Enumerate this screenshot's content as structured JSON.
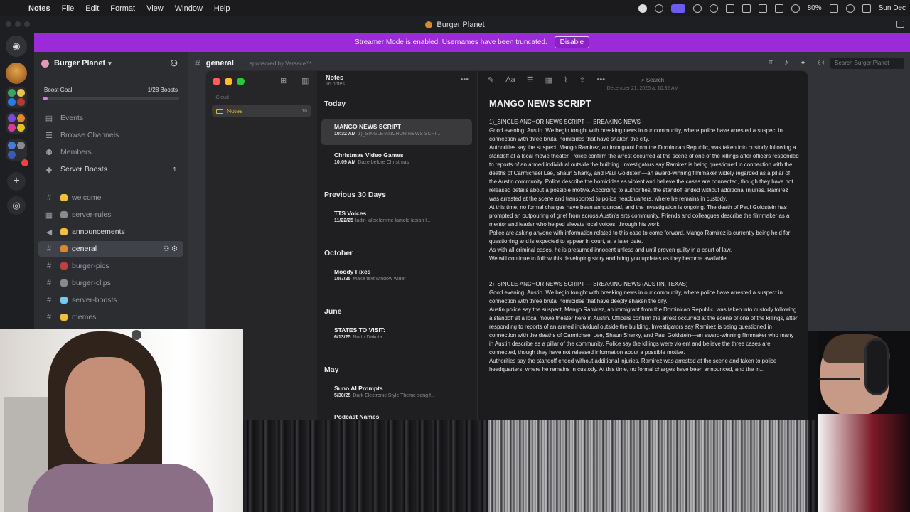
{
  "menubar": {
    "app": "Notes",
    "items": [
      "File",
      "Edit",
      "Format",
      "View",
      "Window",
      "Help"
    ],
    "battery": "80%",
    "clock": "Sun Dec"
  },
  "discord": {
    "window_title": "Burger Planet",
    "banner": {
      "text": "Streamer Mode is enabled. Usernames have been truncated.",
      "button": "Disable"
    },
    "server": {
      "name": "Burger Planet",
      "boost_goal": "Boost Goal",
      "boost_count": "1/28 Boosts",
      "boost_progress": 0.036
    },
    "nav": [
      {
        "label": "Events",
        "icon": "calendar-icon"
      },
      {
        "label": "Browse Channels",
        "icon": "browse-icon"
      },
      {
        "label": "Members",
        "icon": "members-icon"
      },
      {
        "label": "Server Boosts",
        "icon": "boost-icon",
        "count": "1"
      }
    ],
    "channels": [
      {
        "label": "welcome",
        "color": "#f0c040"
      },
      {
        "label": "server-rules",
        "color": "#8a8a8a"
      },
      {
        "label": "announcements",
        "color": "#f0c040"
      },
      {
        "label": "general",
        "color": "#e0842c"
      },
      {
        "label": "burger-pics",
        "color": "#c04040"
      },
      {
        "label": "burger-clips",
        "color": "#8a8a8a"
      },
      {
        "label": "server-boosts",
        "color": "#7ac8f0"
      },
      {
        "label": "memes",
        "color": "#f0c040"
      }
    ],
    "chat": {
      "channel": "general",
      "sponsored": "sponsored by Versace™",
      "search_placeholder": "Search Burger Planet"
    }
  },
  "notes": {
    "list_title": "Notes",
    "list_count": "16 notes",
    "icloud": "iCloud",
    "folder": {
      "label": "Notes",
      "count": "16"
    },
    "search_placeholder": "Search",
    "date_line": "December 21, 2025 at 10:32 AM",
    "sections": [
      {
        "label": "Today"
      },
      {
        "label": "Previous 30 Days"
      },
      {
        "label": "October"
      },
      {
        "label": "June"
      },
      {
        "label": "May"
      }
    ],
    "items": [
      {
        "title": "MANGO NEWS SCRIPT",
        "time": "10:32 AM",
        "preview": "1)_SINGLE-ANCHOR NEWS SCRI..."
      },
      {
        "title": "Christmas Video Games",
        "time": "10:09 AM",
        "preview": "Daze before Christmas"
      },
      {
        "title": "TTS Voices",
        "time": "11/22/25",
        "preview": "ladin lalex lanime lamold lasian l..."
      },
      {
        "title": "Moody Fixes",
        "time": "10/7/25",
        "preview": "Make text window wider"
      },
      {
        "title": "STATES TO VISIT:",
        "time": "6/13/25",
        "preview": "North Dakota"
      },
      {
        "title": "Suno AI Prompts",
        "time": "5/30/25",
        "preview": "Dark Electronic Style Theme song f..."
      },
      {
        "title": "Podcast Names",
        "time": "",
        "preview": ""
      }
    ],
    "editor": {
      "title": "MANGO NEWS SCRIPT",
      "paragraphs": [
        "1)_SINGLE-ANCHOR NEWS SCRIPT — BREAKING NEWS",
        "Good evening, Austin. We begin tonight with breaking news in our community, where police have arrested a suspect in connection with three brutal homicides that have shaken the city.",
        "Authorities say the suspect, Mango Ramirez, an immigrant from the Dominican Republic, was taken into custody following a standoff at a local movie theater. Police confirm the arrest occurred at the scene of one of the killings after officers responded to reports of an armed individual outside the building. Investigators say Ramirez is being questioned in connection with the deaths of Carmichael Lee, Shaun Sharky, and Paul Goldstein—an award-winning filmmaker widely regarded as a pillar of the Austin community. Police describe the homicides as violent and believe the cases are connected, though they have not released details about a possible motive. According to authorities, the standoff ended without additional injuries. Ramirez was arrested at the scene and transported to police headquarters, where he remains in custody.",
        "At this time, no formal charges have been announced, and the investigation is ongoing. The death of Paul Goldstein has prompted an outpouring of grief from across Austin's arts community. Friends and colleagues describe the filmmaker as a mentor and leader who helped elevate local voices, through his work.",
        "Police are asking anyone with information related to this case to come forward. Mango Ramirez is currently being held for questioning and is expected to appear in court, at a later date.",
        "As with all criminal cases, he is presumed innocent unless and until proven guilty in a court of law.",
        "We will continue to follow this developing story and bring you updates as they become available.",
        "",
        "2)_SINGLE-ANCHOR NEWS SCRIPT — BREAKING NEWS (AUSTIN, TEXAS)",
        "Good evening, Austin. We begin tonight with breaking news in our community, where police have arrested a suspect in connection with three brutal homicides that have deeply shaken the city.",
        "Austin police say the suspect, Mango Ramirez, an immigrant from the Dominican Republic, was taken into custody following a standoff at a local movie theater here in Austin. Officers confirm the arrest occurred at the scene of one of the killings, after responding to reports of an armed individual outside the building. Investigators say Ramirez is being questioned in connection with the deaths of Carmichael Lee, Shaun Sharky, and Paul Goldstein—an award-winning filmmaker who many in Austin describe as a pillar of the community. Police say the killings were violent and believe the three cases are connected, though they have not released information about a possible motive.",
        "Authorities say the standoff ended without additional injuries. Ramirez was arrested at the scene and taken to police headquarters, where he remains in custody. At this time, no formal charges have been announced, and the in..."
      ]
    }
  }
}
